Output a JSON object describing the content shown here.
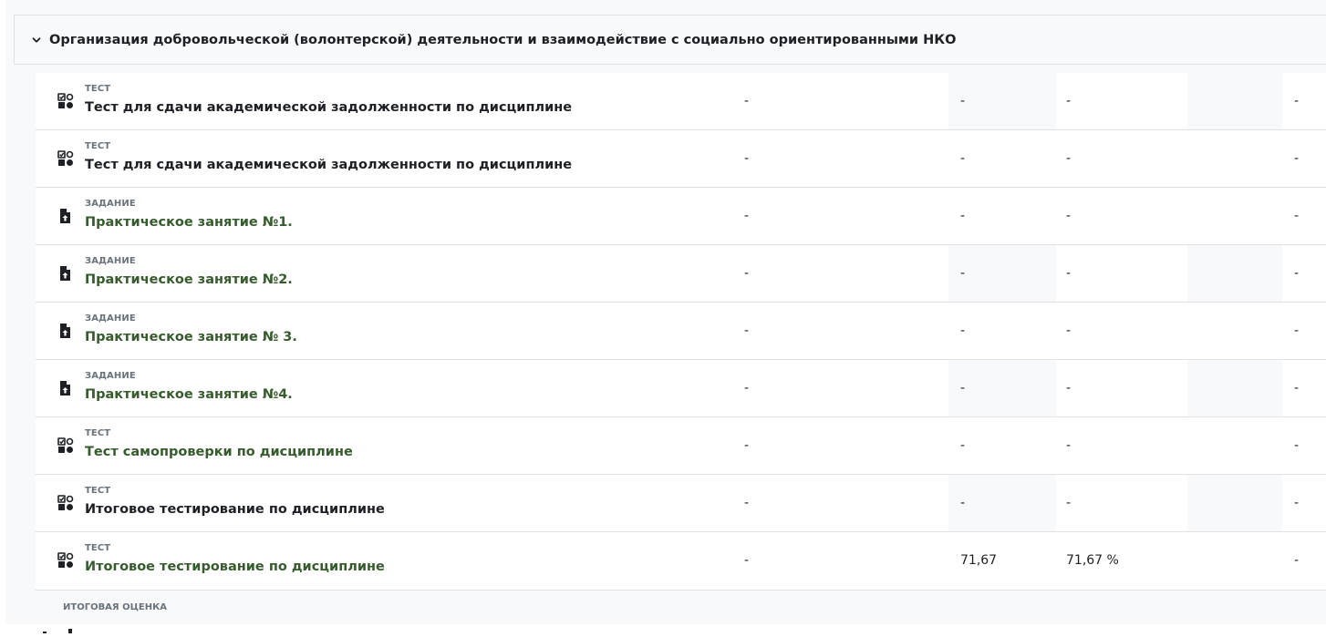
{
  "section": {
    "title": "Организация добровольческой (волонтерской) деятельности и взаимодействие с социально ориентированными НКО",
    "expand_icon": "chevron-down-icon"
  },
  "rows": [
    {
      "type": "Тест",
      "name": "Тест для сдачи академической задолженности по дисциплине",
      "icon": "quiz-icon",
      "link": false,
      "weight": "-",
      "grade": "-",
      "percent": "-",
      "feedback": "-"
    },
    {
      "type": "Тест",
      "name": "Тест для сдачи академической задолженности по дисциплине",
      "icon": "quiz-icon",
      "link": false,
      "weight": "-",
      "grade": "-",
      "percent": "-",
      "feedback": "-"
    },
    {
      "type": "Задание",
      "name": "Практическое занятие №1.",
      "icon": "assignment-icon",
      "link": true,
      "weight": "-",
      "grade": "-",
      "percent": "-",
      "feedback": "-"
    },
    {
      "type": "Задание",
      "name": "Практическое занятие №2.",
      "icon": "assignment-icon",
      "link": true,
      "weight": "-",
      "grade": "-",
      "percent": "-",
      "feedback": "-"
    },
    {
      "type": "Задание",
      "name": "Практическое занятие № 3.",
      "icon": "assignment-icon",
      "link": true,
      "weight": "-",
      "grade": "-",
      "percent": "-",
      "feedback": "-"
    },
    {
      "type": "Задание",
      "name": "Практическое занятие №4.",
      "icon": "assignment-icon",
      "link": true,
      "weight": "-",
      "grade": "-",
      "percent": "-",
      "feedback": "-"
    },
    {
      "type": "Тест",
      "name": "Тест самопроверки по дисциплине",
      "icon": "quiz-icon",
      "link": true,
      "weight": "-",
      "grade": "-",
      "percent": "-",
      "feedback": "-"
    },
    {
      "type": "Тест",
      "name": "Итоговое тестирование по дисциплине",
      "icon": "quiz-icon",
      "link": false,
      "weight": "-",
      "grade": "-",
      "percent": "-",
      "feedback": "-"
    },
    {
      "type": "Тест",
      "name": "Итоговое тестирование по дисциплине",
      "icon": "quiz-icon",
      "link": true,
      "weight": "-",
      "grade": "71,67",
      "percent": "71,67 %",
      "feedback": "-"
    }
  ],
  "total": {
    "label": "Итоговая оценка"
  },
  "colors": {
    "link": "#365b2c",
    "text": "#1d2125",
    "muted": "#6a737b",
    "border": "#dee2e6",
    "stripe": "#f8f9fa"
  }
}
